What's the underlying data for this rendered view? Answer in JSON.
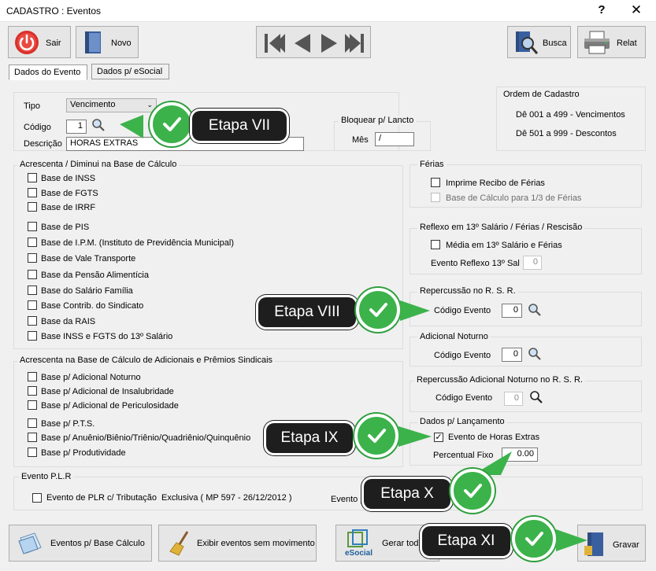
{
  "window": {
    "title": "CADASTRO : Eventos",
    "help": "?",
    "close": "✕"
  },
  "toolbar": {
    "sair": "Sair",
    "novo": "Novo",
    "busca": "Busca",
    "relat": "Relat"
  },
  "tabs": [
    "Dados do Evento",
    "Dados p/ eSocial"
  ],
  "form": {
    "tipo_label": "Tipo",
    "tipo_value": "Vencimento",
    "codigo_label": "Código",
    "codigo_value": "1",
    "descricao_label": "Descrição",
    "descricao_value": "HORAS EXTRAS"
  },
  "bloquear": {
    "title": "Bloquear p/ Lancto",
    "mes_label": "Mês",
    "mes_value": "/"
  },
  "ordem": {
    "title": "Ordem de Cadastro",
    "line1": "Dê 001 a 499 - Vencimentos",
    "line2": "Dê 501 a 999 - Descontos"
  },
  "base_calculo": {
    "title": "Acrescenta / Diminui na Base de Cálculo",
    "items": [
      "Base de INSS",
      "Base de FGTS",
      "Base de IRRF",
      "Base de PIS",
      "Base de I.P.M. (Instituto de Previdência Municipal)",
      "Base de Vale Transporte",
      "Base da Pensão Alimentícia",
      "Base do Salário Família",
      "Base Contrib. do Sindicato",
      "Base da RAIS",
      "Base INSS e FGTS do 13º Salário"
    ]
  },
  "adicionais": {
    "title": "Acrescenta na Base de Cálculo de Adicionais e Prêmios Sindicais",
    "items": [
      "Base p/ Adicional Noturno",
      "Base p/ Adicional de Insalubridade",
      "Base p/ Adicional de Periculosidade",
      "Base p/ P.T.S.",
      "Base p/ Anuênio/Biênio/Triênio/Quadriênio/Quinquênio",
      "Base p/ Produtividade"
    ]
  },
  "ferias": {
    "title": "Férias",
    "item1": "Imprime Recibo de Férias",
    "item2": "Base de Cálculo para 1/3 de Férias"
  },
  "reflexo": {
    "title": "Reflexo em 13º Salário / Férias / Rescisão",
    "item1": "Média em 13º Salário e Férias",
    "evento_label": "Evento Reflexo 13º Sal",
    "evento_value": "0"
  },
  "repercussao": {
    "title": "Repercussão no R. S. R.",
    "label": "Código Evento",
    "value": "0"
  },
  "noturno": {
    "title": "Adicional Noturno",
    "label": "Código Evento",
    "value": "0"
  },
  "rep_noturno": {
    "title": "Repercussão Adicional Noturno no R. S. R.",
    "label": "Código Evento",
    "value": "0"
  },
  "lancamento": {
    "title": "Dados p/ Lançamento",
    "check_label": "Evento de Horas Extras",
    "checked": true,
    "pct_label": "Percentual Fixo",
    "pct_value": "0.00"
  },
  "plr": {
    "title": "Evento P.L.R",
    "check_label": "Evento de PLR c/ Tributação",
    "note": "Exclusiva ( MP 597 - 26/12/2012 )",
    "evento_label": "Evento p"
  },
  "bottom": {
    "eventos_base": "Eventos p/ Base Cálculo",
    "exibir": "Exibir eventos sem movimento",
    "gerar": "Gerar todos o",
    "esocial": "eSocial",
    "gravar": "Gravar"
  },
  "callouts": {
    "vii": "Etapa VII",
    "viii": "Etapa VIII",
    "ix": "Etapa IX",
    "x": "Etapa X",
    "xi": "Etapa XI"
  },
  "colors": {
    "callout_bg": "#1e1e1e",
    "check_green": "#3cb24b",
    "sair_red": "#d9302b"
  }
}
